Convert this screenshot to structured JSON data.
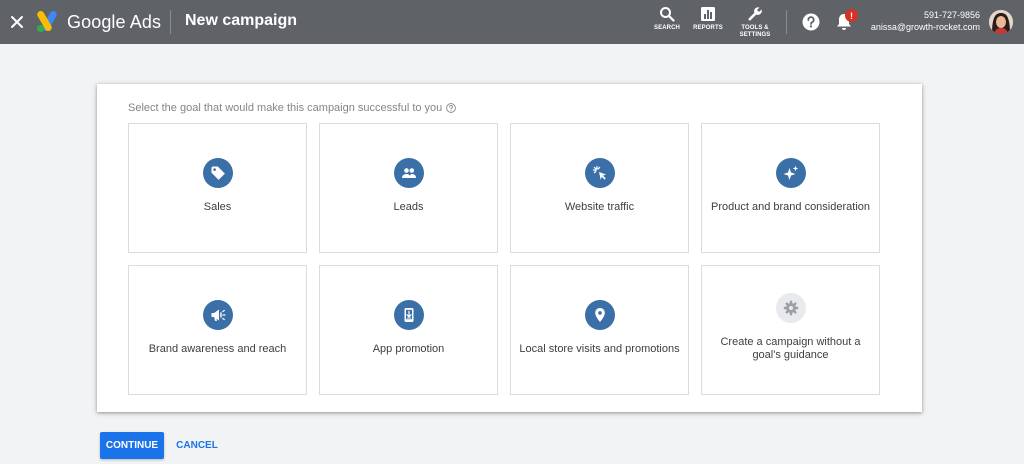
{
  "header": {
    "brand": "Google Ads",
    "title": "New campaign",
    "tools": [
      {
        "label": "SEARCH",
        "icon": "search-icon"
      },
      {
        "label": "REPORTS",
        "icon": "reports-icon"
      },
      {
        "label_line1": "TOOLS &",
        "label_line2": "SETTINGS",
        "icon": "wrench-icon"
      }
    ],
    "notification_count": "!",
    "account_id": "591-727-9856",
    "account_email": "anissa@growth-rocket.com"
  },
  "main": {
    "prompt": "Select the goal that would make this campaign successful to you",
    "goals": [
      {
        "label": "Sales",
        "icon": "tag-icon"
      },
      {
        "label": "Leads",
        "icon": "people-icon"
      },
      {
        "label": "Website traffic",
        "icon": "cursor-click-icon"
      },
      {
        "label": "Product and brand consideration",
        "icon": "sparkle-icon"
      },
      {
        "label": "Brand awareness and reach",
        "icon": "megaphone-icon"
      },
      {
        "label": "App promotion",
        "icon": "phone-download-icon"
      },
      {
        "label": "Local store visits and promotions",
        "icon": "location-pin-icon"
      },
      {
        "label": "Create a campaign without a goal's guidance",
        "icon": "gear-icon"
      }
    ]
  },
  "footer": {
    "continue_label": "CONTINUE",
    "cancel_label": "CANCEL"
  },
  "colors": {
    "header_bg": "#5f6368",
    "accent": "#1a73e8",
    "icon_circle": "#3b6fa8",
    "badge": "#d93025"
  }
}
